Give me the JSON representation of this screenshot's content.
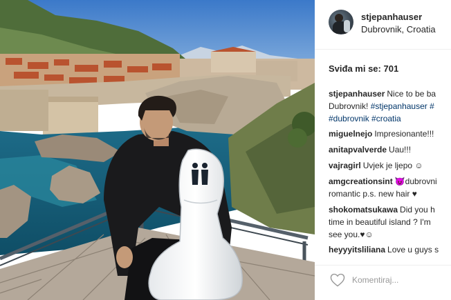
{
  "post": {
    "username": "stjepanhauser",
    "location": "Dubrovnik, Croatia",
    "likes_label": "Sviđa mi se: 701"
  },
  "comments": [
    {
      "user": "stjepanhauser",
      "text": "Nice to be ba",
      "text2": "Dubrovnik! ",
      "tags2": "#stjepanhauser #",
      "tags3": "#dubrovnik #croatia"
    },
    {
      "user": "miguelnejo",
      "text": "Impresionante!!!"
    },
    {
      "user": "anitapvalverde",
      "text": "Uau!!!"
    },
    {
      "user": "vajragirl",
      "text": "Uvjek je ljepo ☺"
    },
    {
      "user": "amgcreationsint",
      "text": "😈dubrovni",
      "text2": "romantic p.s. new hair ♥"
    },
    {
      "user": "shokomatsukawa",
      "text": "Did you h",
      "text2": "time in beautiful island ? I'm",
      "text3": "see you.♥☺"
    },
    {
      "user": "heyyyitsliliana",
      "text": "Love u guys s"
    }
  ],
  "footer": {
    "heart_icon": "heart-outline-icon",
    "comment_placeholder": "Komentiraj..."
  },
  "colors": {
    "hashtag": "#003569",
    "text": "#262626",
    "placeholder": "#999999",
    "divider": "#efefef"
  }
}
